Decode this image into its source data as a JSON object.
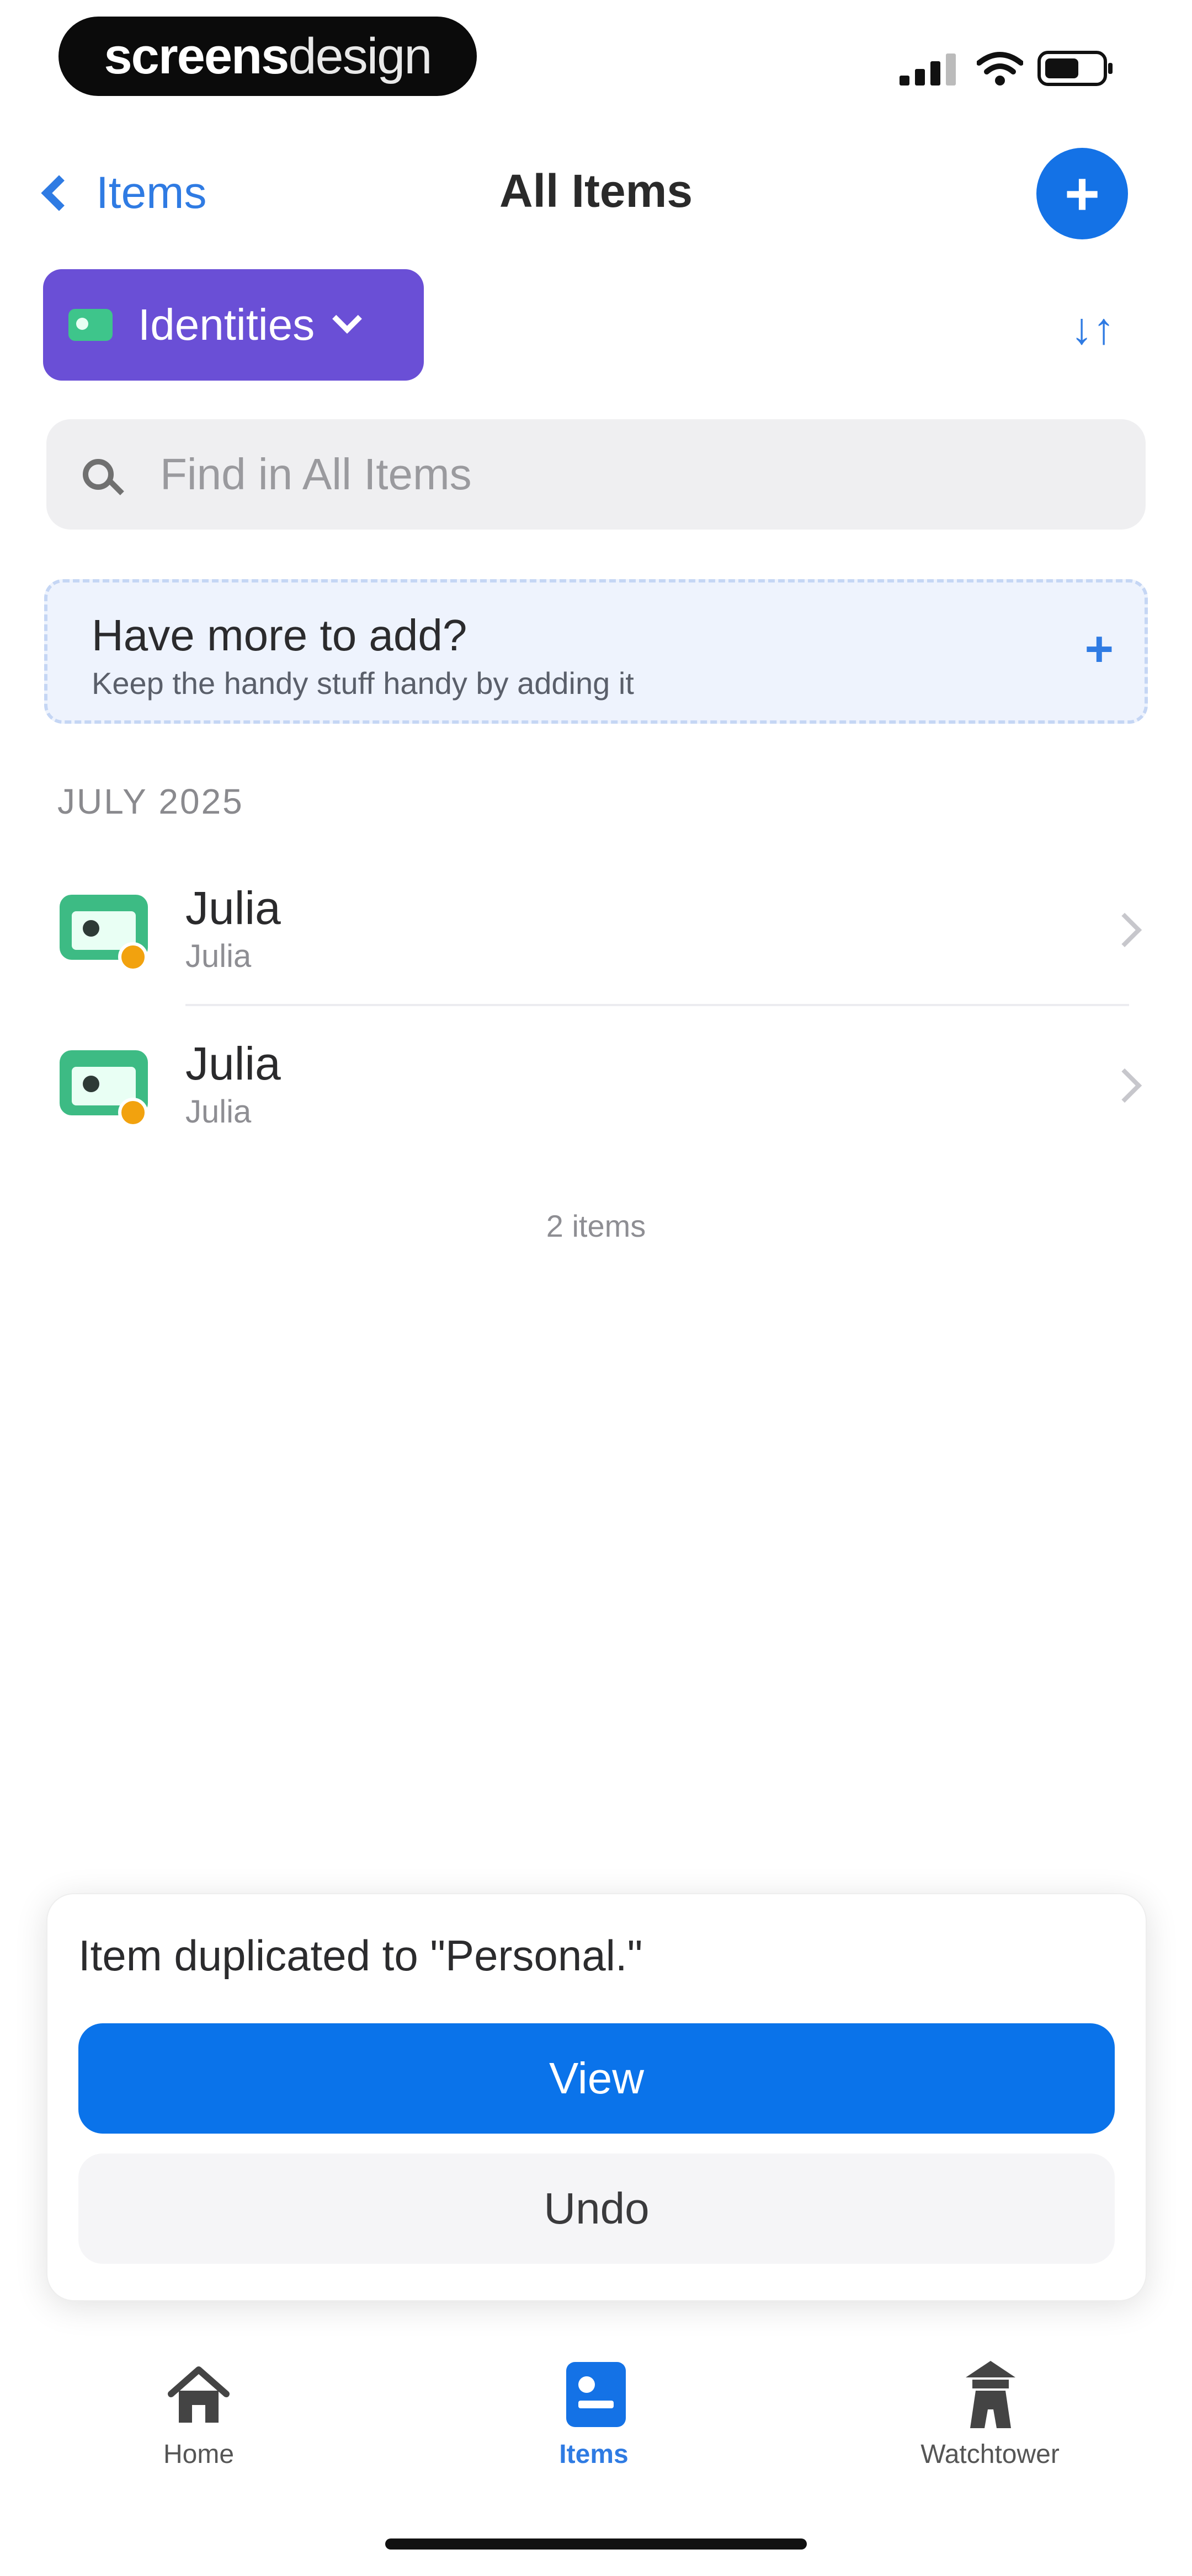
{
  "status_bar": {
    "brand_part1": "screens",
    "brand_part2": "design"
  },
  "nav": {
    "back_label": "Items",
    "title": "All Items",
    "add_icon": "plus-icon"
  },
  "filter": {
    "label": "Identities",
    "icon": "identity-card-icon",
    "sort_icon": "sort-icon"
  },
  "search": {
    "placeholder": "Find in All Items"
  },
  "promo": {
    "title": "Have more to add?",
    "subtitle": "Keep the handy stuff handy by adding it"
  },
  "section": {
    "header": "JULY 2025"
  },
  "items": [
    {
      "title": "Julia",
      "subtitle": "Julia"
    },
    {
      "title": "Julia",
      "subtitle": "Julia"
    }
  ],
  "count_text": "2 items",
  "toast": {
    "message": "Item duplicated to \"Personal.\"",
    "primary_label": "View",
    "secondary_label": "Undo"
  },
  "tabs": [
    {
      "label": "Home",
      "icon": "home-icon"
    },
    {
      "label": "Items",
      "icon": "items-icon"
    },
    {
      "label": "Watchtower",
      "icon": "watchtower-icon"
    }
  ],
  "colors": {
    "accent": "#1472e6",
    "filter_chip": "#6a4fd6",
    "identity_icon": "#3dbb84",
    "favorite_badge": "#f2a20e"
  }
}
